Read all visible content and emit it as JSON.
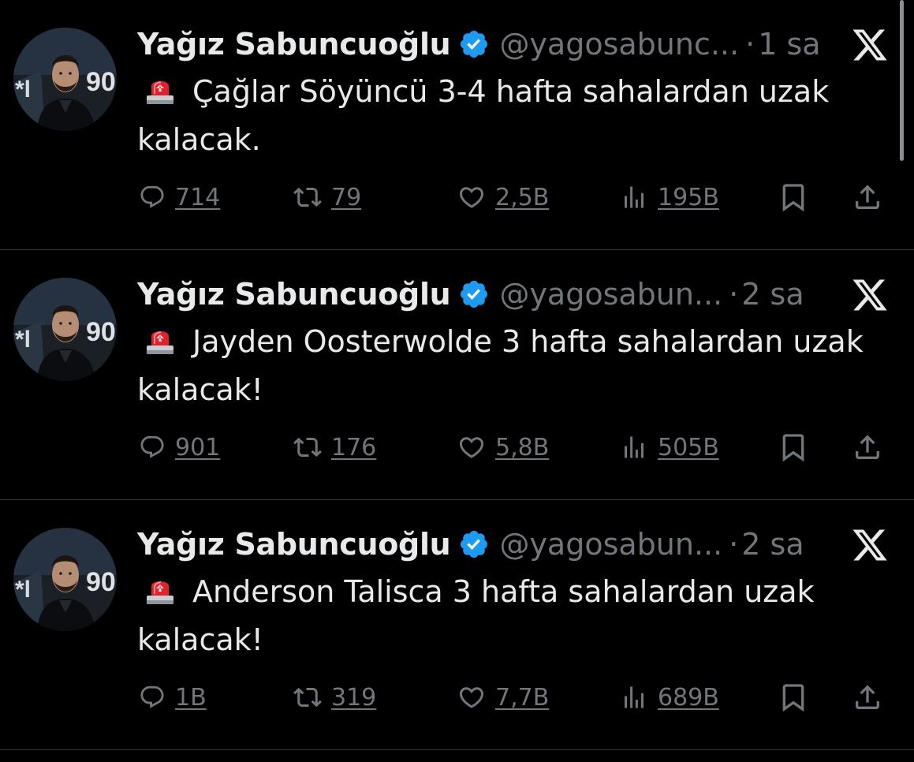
{
  "colors": {
    "background": "#000000",
    "text": "#e7e9ea",
    "secondary": "#71767b",
    "verified": "#1d9bf0",
    "divider": "#2f3336"
  },
  "icons": {
    "verified": "verified-badge-icon",
    "platform": "x-logo-icon",
    "emoji": "police-car-light-emoji",
    "reply": "reply-icon",
    "retweet": "retweet-icon",
    "like": "heart-icon",
    "views": "views-bar-chart-icon",
    "bookmark": "bookmark-icon",
    "share": "share-icon"
  },
  "tweets": [
    {
      "name": "Yağız Sabuncuoğlu",
      "handle": "@yagosabunc...",
      "dot": "·",
      "time": "1 sa",
      "text": "Çağlar Söyüncü 3-4 hafta sahalardan uzak kalacak.",
      "replies": "714",
      "retweets": "79",
      "likes": "2,5B",
      "views": "195B"
    },
    {
      "name": "Yağız Sabuncuoğlu",
      "handle": "@yagosabun...",
      "dot": "·",
      "time": "2 sa",
      "text": "Jayden Oosterwolde 3 hafta sahalardan uzak kalacak!",
      "replies": "901",
      "retweets": "176",
      "likes": "5,8B",
      "views": "505B"
    },
    {
      "name": "Yağız Sabuncuoğlu",
      "handle": "@yagosabun...",
      "dot": "·",
      "time": "2 sa",
      "text": "Anderson Talisca 3 hafta sahalardan uzak kalacak!",
      "replies": "1B",
      "retweets": "319",
      "likes": "7,7B",
      "views": "689B"
    }
  ]
}
